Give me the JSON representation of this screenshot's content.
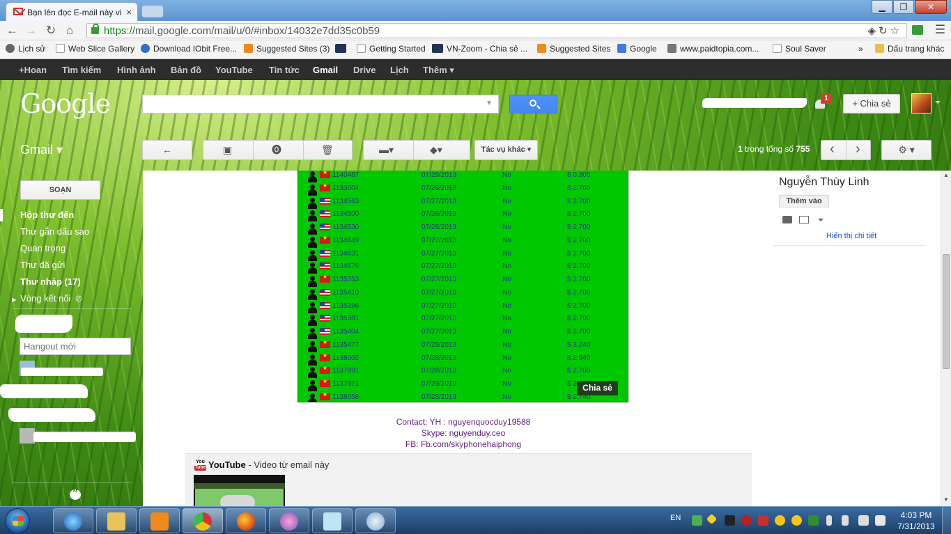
{
  "browser": {
    "tab_title": "Bạn lên đọc E-mail này vi",
    "tab_close": "×",
    "url_scheme": "https://",
    "url_rest": "mail.google.com/mail/u/0/#inbox/14032e7dd35c0b59",
    "bookmarks": [
      "Lịch sử",
      "Web Slice Gallery",
      "Download IObit Free...",
      "Suggested Sites (3)",
      "Getting Started",
      "VN-Zoom - Chia sẻ ...",
      "Suggested Sites",
      "Google",
      "www.paidtopia.com...",
      "Soul Saver"
    ],
    "bookmarks_overflow": "»",
    "other_bookmarks": "Dấu trang khác"
  },
  "gbar": {
    "items": [
      "+Hoan",
      "Tìm kiếm",
      "Hình ảnh",
      "Bản đồ",
      "YouTube",
      "Tin tức",
      "Gmail",
      "Drive",
      "Lịch",
      "Thêm ▾"
    ]
  },
  "header": {
    "logo": "Google",
    "notification_count": "1",
    "share_label": "+ Chia sẻ"
  },
  "toolbar": {
    "gmail_label": "Gmail ▾",
    "back_icon": "←",
    "more_actions": "Tác vụ khác ▾",
    "count_current": "1",
    "count_mid": " trong tổng số ",
    "count_total": "755",
    "prev": "‹",
    "next": "›",
    "settings": "⚙ ▾"
  },
  "nav": {
    "compose": "SOẠN",
    "items": [
      "Hộp thư đến",
      "Thư gắn dấu sao",
      "Quan trọng",
      "Thư đã gửi",
      "Thư nháp (17)",
      "Vòng kết nối"
    ],
    "hangout_placeholder": "Hangout mới"
  },
  "earnings": {
    "rows": [
      {
        "id": "1140487",
        "date": "07/29/2013",
        "status": "No",
        "amount": "$ 0.300",
        "flag": "vn"
      },
      {
        "id": "1133604",
        "date": "07/26/2013",
        "status": "No",
        "amount": "$ 2.700",
        "flag": "vn"
      },
      {
        "id": "1134563",
        "date": "07/27/2013",
        "status": "No",
        "amount": "$ 2.700",
        "flag": "us"
      },
      {
        "id": "1134500",
        "date": "07/26/2013",
        "status": "No",
        "amount": "$ 2.700",
        "flag": "us"
      },
      {
        "id": "1134530",
        "date": "07/26/2013",
        "status": "No",
        "amount": "$ 2.700",
        "flag": "us"
      },
      {
        "id": "1134649",
        "date": "07/27/2013",
        "status": "No",
        "amount": "$ 2.700",
        "flag": "vn"
      },
      {
        "id": "1134631",
        "date": "07/27/2013",
        "status": "No",
        "amount": "$ 2.700",
        "flag": "us"
      },
      {
        "id": "1134676",
        "date": "07/27/2013",
        "status": "No",
        "amount": "$ 2.700",
        "flag": "us"
      },
      {
        "id": "1135353",
        "date": "07/27/2013",
        "status": "No",
        "amount": "$ 2.700",
        "flag": "vn"
      },
      {
        "id": "1135410",
        "date": "07/27/2013",
        "status": "No",
        "amount": "$ 2.700",
        "flag": "us"
      },
      {
        "id": "1135396",
        "date": "07/27/2013",
        "status": "No",
        "amount": "$ 2.700",
        "flag": "us"
      },
      {
        "id": "1135381",
        "date": "07/27/2013",
        "status": "No",
        "amount": "$ 2.700",
        "flag": "us"
      },
      {
        "id": "1135404",
        "date": "07/27/2013",
        "status": "No",
        "amount": "$ 2.700",
        "flag": "us"
      },
      {
        "id": "1135477",
        "date": "07/29/2013",
        "status": "No",
        "amount": "$ 3.240",
        "flag": "vn"
      },
      {
        "id": "1138002",
        "date": "07/28/2013",
        "status": "No",
        "amount": "$ 2.940",
        "flag": "vn"
      },
      {
        "id": "1137991",
        "date": "07/28/2013",
        "status": "No",
        "amount": "$ 2.700",
        "flag": "vn"
      },
      {
        "id": "1137971",
        "date": "07/29/2013",
        "status": "No",
        "amount": "$ 2.700",
        "flag": "vn"
      },
      {
        "id": "1138058",
        "date": "07/28/2013",
        "status": "No",
        "amount": "$ 2.740",
        "flag": "vn"
      }
    ],
    "share_overlay": "Chia sẻ"
  },
  "message": {
    "contact_yh": "Contact: YH : nguyenquocduy19588",
    "contact_skype": "Skype: nguyenduy.ceo",
    "contact_fb": "FB: Fb.com/skyphonehaiphong",
    "yt_logo_you": "You",
    "yt_logo_tube": "Tube",
    "yt_brand": "YouTube",
    "yt_suffix": " - Video từ email này"
  },
  "contact_card": {
    "name": "Nguyễn Thùy Linh",
    "add_label": "Thêm vào",
    "details_link": "Hiển thị chi tiết"
  },
  "taskbar": {
    "lang": "EN",
    "time": "4:03 PM",
    "date": "7/31/2013"
  },
  "colors": {
    "earnings_bg": "#00c800",
    "search_button": "#4d90fe",
    "badge": "#d23f31",
    "gbar_bg": "#2d2d2d"
  }
}
